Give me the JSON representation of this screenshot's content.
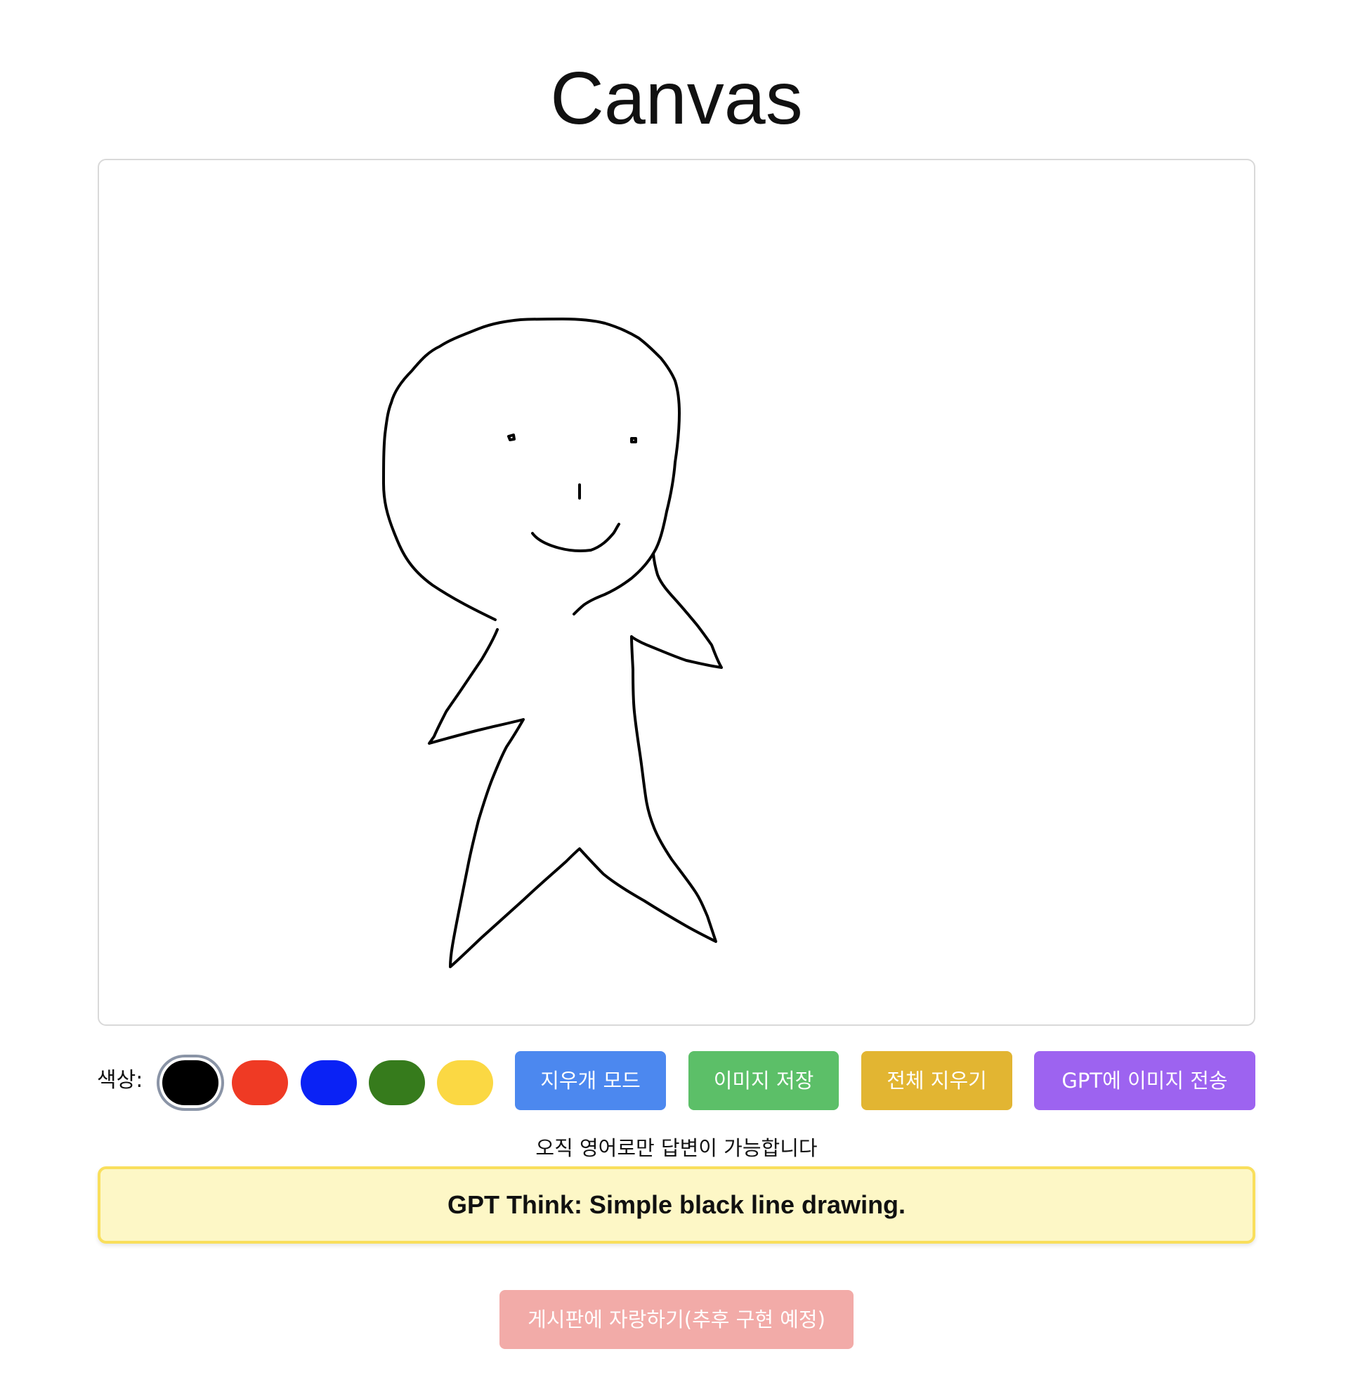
{
  "page": {
    "title": "Canvas"
  },
  "toolbar": {
    "color_label": "색상:",
    "colors": [
      {
        "name": "black",
        "hex": "#000000",
        "selected": true
      },
      {
        "name": "red",
        "hex": "#ef3a24"
      },
      {
        "name": "blue",
        "hex": "#0a22f5"
      },
      {
        "name": "green",
        "hex": "#367b1c"
      },
      {
        "name": "yellow",
        "hex": "#fbd843"
      }
    ],
    "buttons": {
      "eraser": {
        "label": "지우개 모드",
        "color": "#4c88ef"
      },
      "save": {
        "label": "이미지 저장",
        "color": "#5cbf68"
      },
      "clear": {
        "label": "전체 지우기",
        "color": "#e2b532"
      },
      "send_gpt": {
        "label": "GPT에 이미지 전송",
        "color": "#9d63f0"
      }
    }
  },
  "notice": "오직 영어로만 답변이 가능합니다",
  "gpt_response": {
    "text": "GPT Think: Simple black line drawing.",
    "background": "#fdf7c6",
    "border": "#f9df5c"
  },
  "share_button": {
    "label": "게시판에 자랑하기(추후 구현 예정)",
    "color": "#f2aba8"
  },
  "drawing": {
    "stroke_color": "#000000"
  }
}
